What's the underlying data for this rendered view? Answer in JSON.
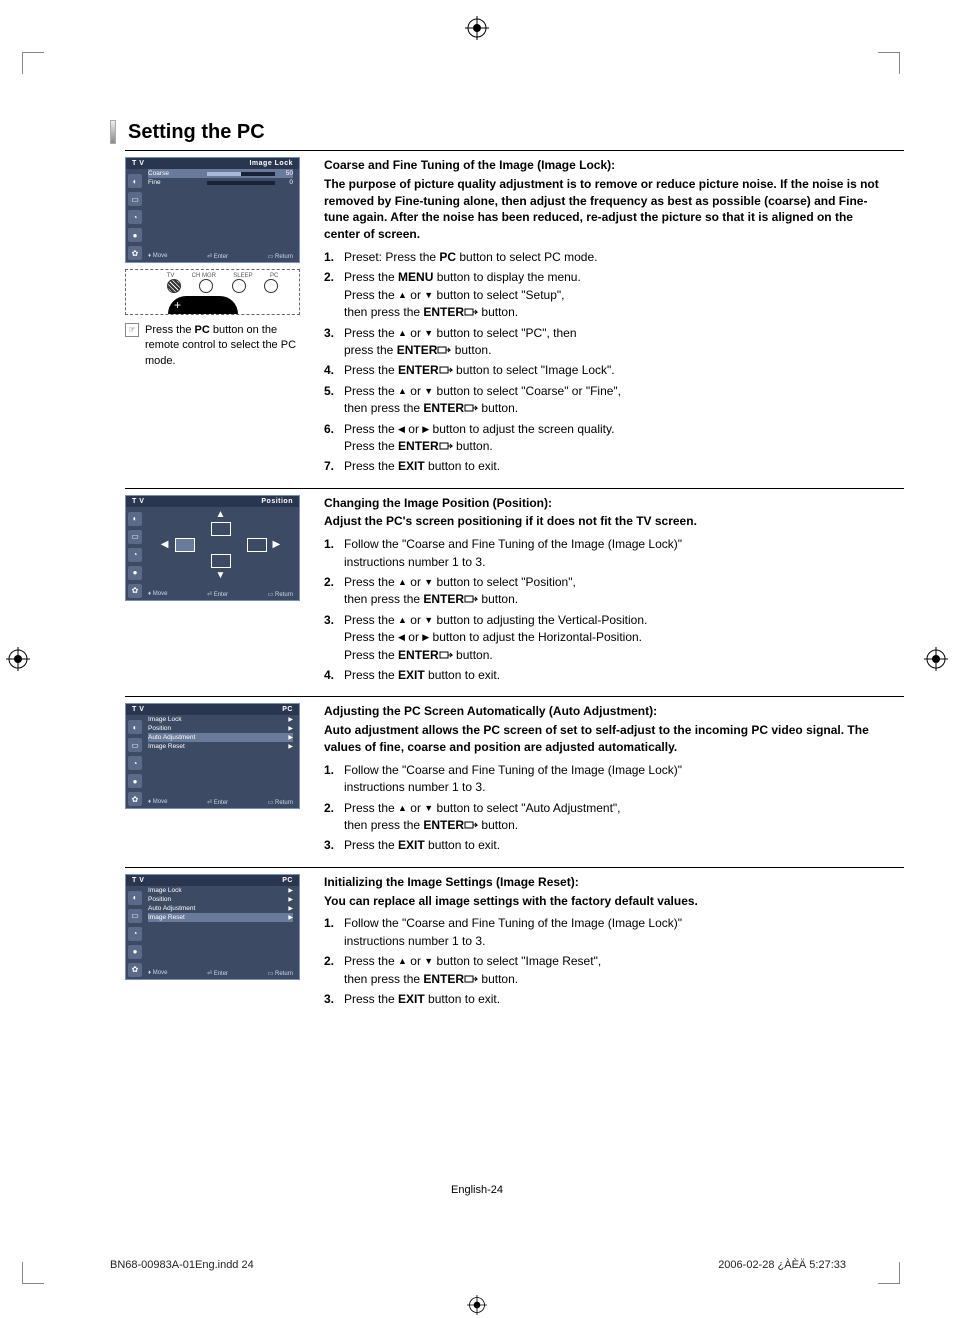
{
  "heading": "Setting the PC",
  "osd1": {
    "tv": "T V",
    "title": "Image Lock",
    "rows": [
      {
        "label": "Coarse",
        "value": "50",
        "fill": 50
      },
      {
        "label": "Fine",
        "value": "0",
        "fill": 0
      }
    ],
    "footer": {
      "move": "Move",
      "enter": "Enter",
      "return": "Return"
    }
  },
  "osd2": {
    "tv": "T V",
    "title": "Position",
    "footer": {
      "move": "Move",
      "enter": "Enter",
      "return": "Return"
    }
  },
  "osd3": {
    "tv": "T V",
    "title": "PC",
    "rows": [
      "Image Lock",
      "Position",
      "Auto Adjustment",
      "Image Reset"
    ],
    "selected": 2,
    "footer": {
      "move": "Move",
      "enter": "Enter",
      "return": "Return"
    }
  },
  "osd4": {
    "tv": "T V",
    "title": "PC",
    "rows": [
      "Image Lock",
      "Position",
      "Auto Adjustment",
      "Image Reset"
    ],
    "selected": 3,
    "footer": {
      "move": "Move",
      "enter": "Enter",
      "return": "Return"
    }
  },
  "remote": {
    "labels": [
      "TV",
      "CH MGR",
      "SLEEP",
      "PC"
    ]
  },
  "caption": {
    "pre": "Press the ",
    "bold": "PC",
    "post": " button on the remote control to select the PC mode."
  },
  "sectionA": {
    "title": "Coarse and Fine Tuning of the Image (Image Lock):",
    "sub": "The purpose of picture quality adjustment is to remove or reduce picture noise. If the noise is not removed by Fine-tuning alone, then adjust the frequency as best as possible (coarse) and Fine-tune again. After the noise has been reduced, re-adjust the picture so that it is aligned on the center of screen.",
    "steps": [
      "Preset: Press the |PC| button to select PC mode.",
      "Press the |MENU| button to display the menu.\nPress the ▲ or ▼ button to select \"Setup\",\nthen press the |ENTER|⏎ button.",
      "Press the ▲ or ▼ button to select \"PC\", then\npress the |ENTER|⏎ button.",
      "Press the |ENTER|⏎ button to select \"Image Lock\".",
      "Press the ▲ or ▼ button to select \"Coarse\" or \"Fine\",\nthen press the |ENTER|⏎ button.",
      "Press the ◀ or ▶ button to adjust the screen quality.\nPress the |ENTER|⏎ button.",
      "Press the |EXIT| button to exit."
    ]
  },
  "sectionB": {
    "title": "Changing the Image Position (Position):",
    "sub": "Adjust the PC's screen positioning if it does not fit the TV screen.",
    "steps": [
      "Follow the \"Coarse and Fine Tuning of the Image (Image Lock)\"\ninstructions number 1 to 3.",
      "Press the ▲ or ▼ button to select \"Position\",\nthen press the |ENTER|⏎ button.",
      "Press the ▲ or ▼ button to adjusting the Vertical-Position.\nPress the ◀ or ▶ button to adjust the Horizontal-Position.\nPress the |ENTER|⏎ button.",
      "Press the |EXIT| button to exit."
    ]
  },
  "sectionC": {
    "title": "Adjusting the PC Screen Automatically (Auto Adjustment):",
    "sub": "Auto adjustment allows the PC screen of set to self-adjust to the incoming PC video signal. The values of fine, coarse and position are adjusted automatically.",
    "steps": [
      "Follow the \"Coarse and Fine Tuning of the Image (Image Lock)\"\ninstructions number 1 to 3.",
      "Press the ▲ or ▼ button to select \"Auto Adjustment\",\nthen press the |ENTER|⏎ button.",
      "Press the |EXIT| button to exit."
    ]
  },
  "sectionD": {
    "title": "Initializing the Image Settings (Image Reset):",
    "sub": "You can replace all image settings with the factory default values.",
    "steps": [
      "Follow the \"Coarse and Fine Tuning of the Image (Image Lock)\"\ninstructions number 1 to 3.",
      "Press the ▲ or ▼ button to select \"Image Reset\",\nthen press the |ENTER|⏎ button.",
      "Press the |EXIT| button to exit."
    ]
  },
  "footer": {
    "page": "English-24",
    "left": "BN68-00983A-01Eng.indd   24",
    "right": "2006-02-28   ¿ÀÈÄ 5:27:33"
  }
}
